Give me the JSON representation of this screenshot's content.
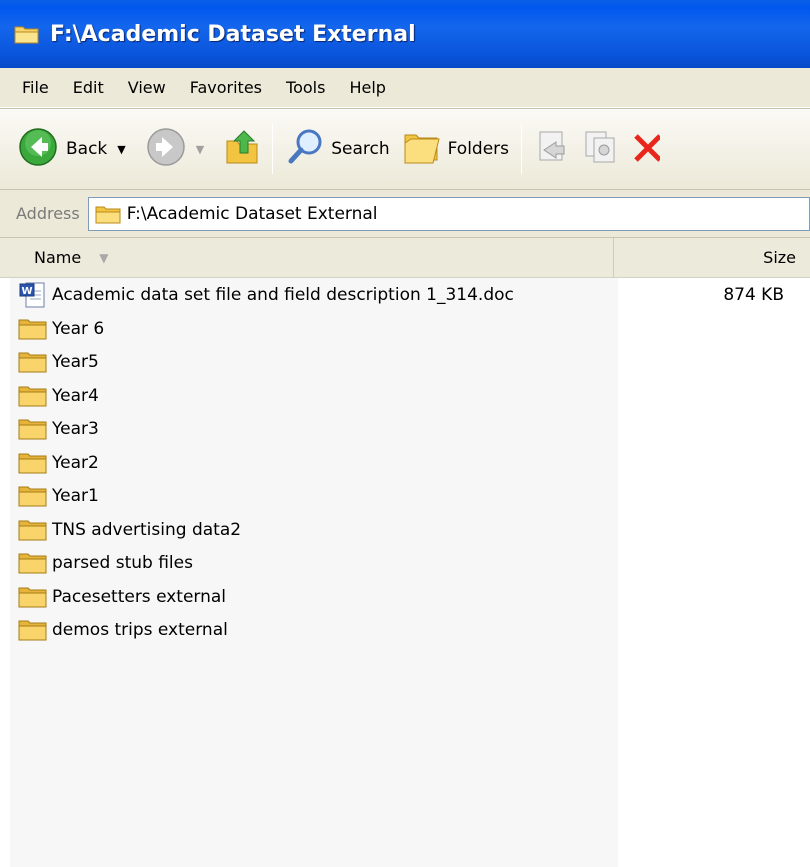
{
  "window": {
    "title": "F:\\Academic Dataset External"
  },
  "menu": [
    "File",
    "Edit",
    "View",
    "Favorites",
    "Tools",
    "Help"
  ],
  "toolbar": {
    "back_label": "Back",
    "search_label": "Search",
    "folders_label": "Folders",
    "icons": [
      "back-arrow-icon",
      "forward-arrow-icon",
      "up-folder-icon",
      "search-icon",
      "folders-icon",
      "move-to-icon",
      "copy-to-icon",
      "delete-icon"
    ]
  },
  "address": {
    "label": "Address",
    "value": "F:\\Academic Dataset External"
  },
  "columns": {
    "name": "Name",
    "size": "Size"
  },
  "files": [
    {
      "name": "Academic data set file and field description 1_314.doc",
      "size": "874 KB",
      "type": "word-doc"
    },
    {
      "name": "Year 6",
      "size": "",
      "type": "folder"
    },
    {
      "name": "Year5",
      "size": "",
      "type": "folder"
    },
    {
      "name": "Year4",
      "size": "",
      "type": "folder"
    },
    {
      "name": "Year3",
      "size": "",
      "type": "folder"
    },
    {
      "name": "Year2",
      "size": "",
      "type": "folder"
    },
    {
      "name": "Year1",
      "size": "",
      "type": "folder"
    },
    {
      "name": "TNS advertising data2",
      "size": "",
      "type": "folder"
    },
    {
      "name": "parsed stub files",
      "size": "",
      "type": "folder"
    },
    {
      "name": "Pacesetters external",
      "size": "",
      "type": "folder"
    },
    {
      "name": "demos trips external",
      "size": "",
      "type": "folder"
    }
  ],
  "colors": {
    "titlebar": "#0058ee",
    "chrome": "#ece9d8",
    "folder": "#f4c84a",
    "delete": "#e8261c"
  }
}
